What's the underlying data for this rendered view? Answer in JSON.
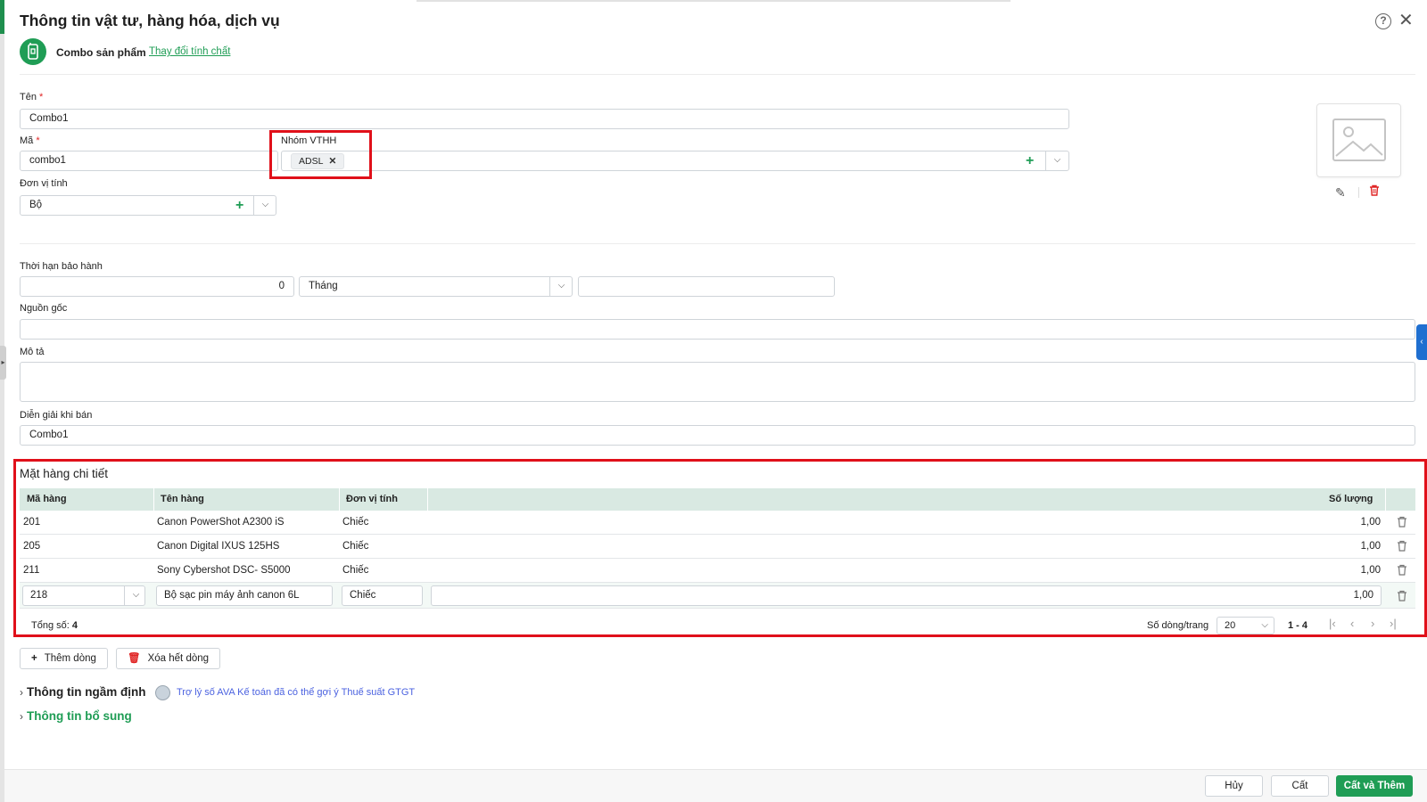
{
  "header": {
    "title": "Thông tin vật tư, hàng hóa, dịch vụ",
    "help_glyph": "?",
    "close_glyph": "✕"
  },
  "nature": {
    "label": "Combo sản phẩm",
    "change_link": "Thay đổi tính chất"
  },
  "form": {
    "name_label": "Tên",
    "name_value": "Combo1",
    "code_label": "Mã",
    "code_value": "combo1",
    "group_label": "Nhóm VTHH",
    "group_chip": "ADSL",
    "unit_label": "Đơn vị tính",
    "unit_value": "Bộ",
    "required_mark": "*",
    "warranty_label": "Thời hạn bảo hành",
    "warranty_value": "0",
    "warranty_unit": "Tháng",
    "origin_label": "Nguồn gốc",
    "description_label": "Mô tả",
    "sales_desc_label": "Diễn giải khi bán",
    "sales_desc_value": "Combo1"
  },
  "details": {
    "title": "Mặt hàng chi tiết",
    "columns": [
      "Mã hàng",
      "Tên hàng",
      "Đơn vị tính",
      "Số lượng"
    ],
    "rows": [
      {
        "code": "201",
        "name": "Canon PowerShot A2300 iS",
        "unit": "Chiếc",
        "qty": "1,00"
      },
      {
        "code": "205",
        "name": "Canon Digital IXUS 125HS",
        "unit": "Chiếc",
        "qty": "1,00"
      },
      {
        "code": "211",
        "name": "Sony Cybershot DSC- S5000",
        "unit": "Chiếc",
        "qty": "1,00"
      }
    ],
    "edit_row": {
      "code": "218",
      "name": "Bộ sạc pin máy ảnh canon 6L",
      "unit": "Chiếc",
      "qty": "1,00"
    },
    "total_label": "Tổng số:",
    "total_value": "4",
    "rows_per_page_label": "Số dòng/trang",
    "rows_per_page": "20",
    "range": "1 - 4"
  },
  "actions": {
    "add_row": "Thêm dòng",
    "clear_rows": "Xóa hết dòng"
  },
  "sections": {
    "default_info": "Thông tin ngầm định",
    "ai_hint": "Trợ lý số AVA Kế toán đã có thể gợi ý Thuế suất GTGT",
    "extra_info": "Thông tin bổ sung"
  },
  "footer": {
    "cancel": "Hủy",
    "save": "Cất",
    "save_add": "Cất và Thêm"
  },
  "colors": {
    "brand_green": "#1f9d55",
    "highlight_red": "#e0101a",
    "table_header": "#d9e9e2",
    "ai_blue": "#4b62e0"
  }
}
